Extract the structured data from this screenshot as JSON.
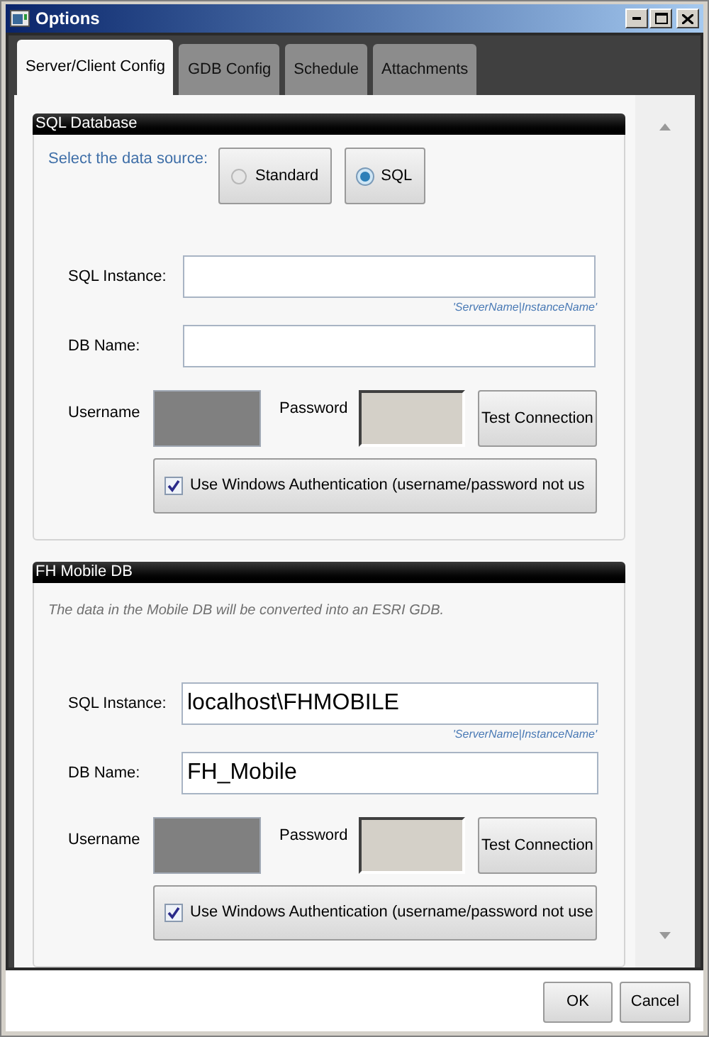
{
  "window": {
    "title": "Options"
  },
  "tabs": [
    {
      "label": "Server/Client Config",
      "selected": true
    },
    {
      "label": "GDB Config",
      "selected": false
    },
    {
      "label": "Schedule",
      "selected": false
    },
    {
      "label": "Attachments",
      "selected": false
    }
  ],
  "groups": [
    {
      "title": "SQL Database",
      "kind": "sql",
      "source_label": "Select the data source:",
      "sources": [
        {
          "label": "Standard",
          "selected": false
        },
        {
          "label": "SQL",
          "selected": true
        }
      ],
      "instance": {
        "label": "SQL Instance:",
        "hint": "'ServerName|InstanceName'"
      },
      "db_name": {
        "label": "DB Name:"
      },
      "username": {
        "label": "Username",
        "disabled": true
      },
      "password": {
        "label": "Password",
        "disabled": true
      },
      "test_button": "Test Connection",
      "windows_auth": {
        "label": "Use Windows Authentication (username/password not us",
        "checked": true
      }
    },
    {
      "title": "FH Mobile DB",
      "kind": "mobile",
      "description": "The data in the Mobile DB will be converted into an ESRI GDB.",
      "instance": {
        "label": "SQL Instance:",
        "value": "localhost\\FHMOBILE",
        "hint": "'ServerName|InstanceName'"
      },
      "db_name": {
        "label": "DB Name:",
        "value": "FH_Mobile"
      },
      "username": {
        "label": "Username",
        "disabled": true
      },
      "password": {
        "label": "Password",
        "disabled": true
      },
      "test_button": "Test Connection",
      "windows_auth": {
        "label": "Use Windows Authentication (username/password not use",
        "checked": true
      }
    }
  ],
  "buttons": [
    "OK",
    "Cancel"
  ]
}
